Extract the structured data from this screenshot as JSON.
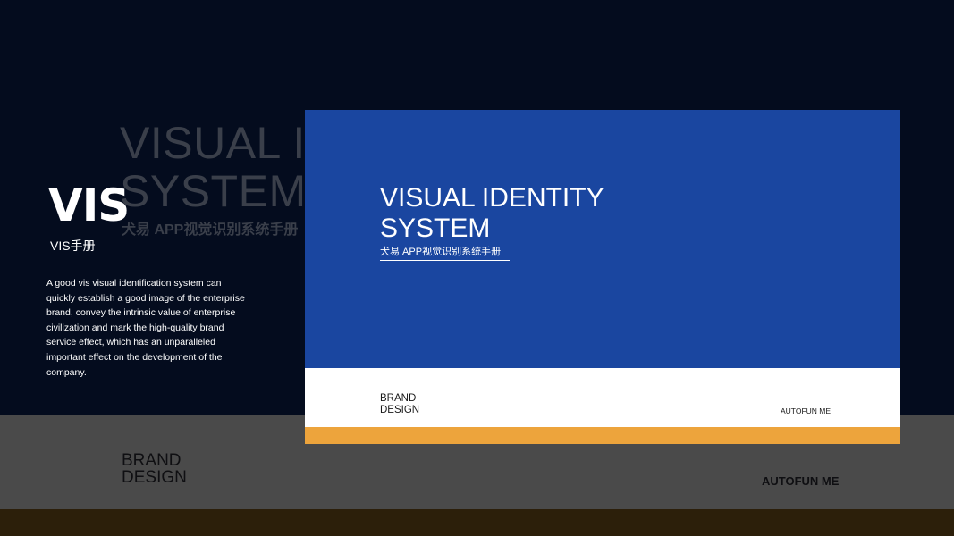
{
  "background": {
    "ghost_title_line1": "VISUAL IDENTITY",
    "ghost_title_line2": "SYSTEM",
    "ghost_subtitle": "犬易 APP视觉识别系统手册",
    "ghost_brand": "BRAND DESIGN",
    "ghost_autofun": "AUTOFUN ME"
  },
  "sidebar": {
    "logo": "VIS",
    "subtitle": "VIS手册",
    "description": "A good vis visual identification system can quickly establish a good image of the enterprise brand, convey the intrinsic value of enterprise civilization and mark the high-quality brand service effect, which has an unparalleled important effect on the development of the company."
  },
  "card": {
    "title_line1": "VISUAL IDENTITY",
    "title_line2": "SYSTEM",
    "subtitle": "犬易 APP视觉识别系统手册",
    "brand": "BRAND DESIGN",
    "footer_right": "AUTOFUN ME"
  },
  "colors": {
    "navy": "#040c1e",
    "card_blue": "#1a46a0",
    "accent_orange": "#eda43c",
    "gray_band": "#4a4a4a"
  }
}
